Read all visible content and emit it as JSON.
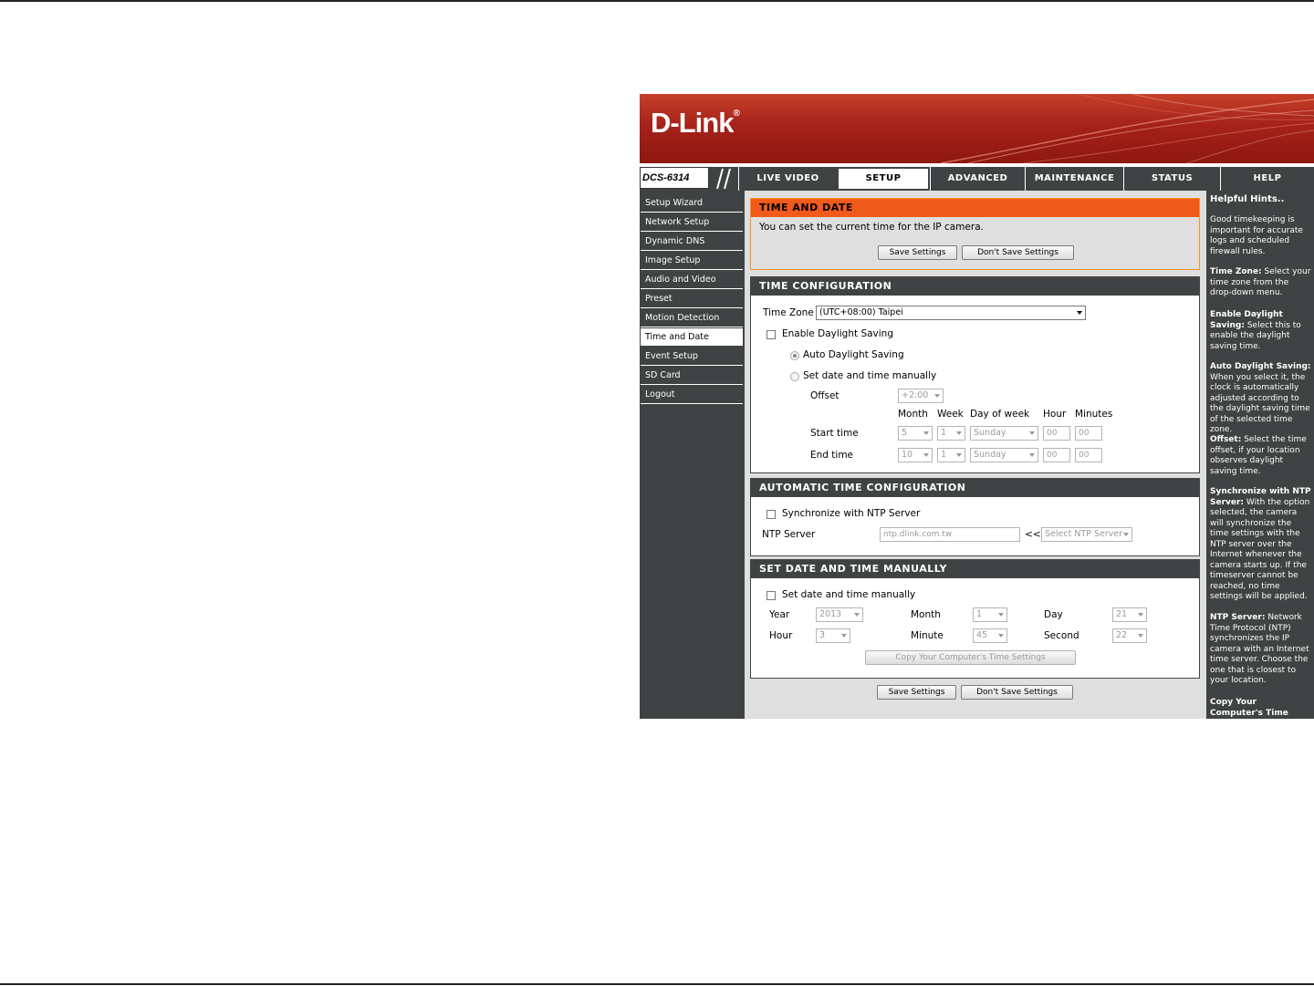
{
  "brand": {
    "logo_text": "D-Link",
    "registered": "®",
    "model": "DCS-6314"
  },
  "nav": {
    "tabs": [
      {
        "label": "LIVE VIDEO"
      },
      {
        "label": "SETUP",
        "active": true
      },
      {
        "label": "ADVANCED"
      },
      {
        "label": "MAINTENANCE"
      },
      {
        "label": "STATUS"
      },
      {
        "label": "HELP"
      }
    ]
  },
  "sidebar": {
    "items": [
      {
        "label": "Setup Wizard"
      },
      {
        "label": "Network Setup"
      },
      {
        "label": "Dynamic DNS"
      },
      {
        "label": "Image Setup"
      },
      {
        "label": "Audio and Video"
      },
      {
        "label": "Preset"
      },
      {
        "label": "Motion Detection"
      },
      {
        "label": "Time and Date",
        "active": true
      },
      {
        "label": "Event Setup"
      },
      {
        "label": "SD Card"
      },
      {
        "label": "Logout"
      }
    ]
  },
  "intro": {
    "title": "TIME AND DATE",
    "description": "You can set the current time for the IP camera.",
    "save_label": "Save Settings",
    "dont_save_label": "Don't Save Settings"
  },
  "time_config": {
    "title": "TIME CONFIGURATION",
    "time_zone_label": "Time Zone",
    "time_zone_value": "(UTC+08:00) Taipei",
    "daylight_label": "Enable Daylight Saving",
    "auto_daylight_label": "Auto Daylight Saving",
    "manual_daylight_label": "Set date and time manually",
    "offset_label": "Offset",
    "offset_value": "+2:00",
    "col_month": "Month",
    "col_week": "Week",
    "col_dow": "Day of week",
    "col_hour": "Hour",
    "col_minutes": "Minutes",
    "start_label": "Start time",
    "start": {
      "month": "5",
      "week": "1",
      "dow": "Sunday",
      "hour": "00",
      "minutes": "00"
    },
    "end_label": "End time",
    "end": {
      "month": "10",
      "week": "1",
      "dow": "Sunday",
      "hour": "00",
      "minutes": "00"
    }
  },
  "auto_time": {
    "title": "AUTOMATIC TIME CONFIGURATION",
    "sync_label": "Synchronize with NTP Server",
    "ntp_label": "NTP Server",
    "ntp_value": "ntp.dlink.com.tw",
    "arrows": "<<",
    "ntp_select": "Select NTP Server"
  },
  "manual_time": {
    "title": "SET DATE AND TIME MANUALLY",
    "set_label": "Set date and time manually",
    "year_label": "Year",
    "year_value": "2013",
    "month_label": "Month",
    "month_value": "1",
    "day_label": "Day",
    "day_value": "21",
    "hour_label": "Hour",
    "hour_value": "3",
    "minute_label": "Minute",
    "minute_value": "45",
    "second_label": "Second",
    "second_value": "22",
    "copy_label": "Copy Your Computer's Time Settings"
  },
  "footer": {
    "save_label": "Save Settings",
    "dont_save_label": "Don't Save Settings"
  },
  "hints": {
    "title": "Helpful Hints..",
    "intro": "Good timekeeping is important for accurate logs and scheduled firewall rules.",
    "tz_term": "Time Zone:",
    "tz_text": "Select your time zone from the drop-down menu.",
    "eds_term": "Enable Daylight Saving:",
    "eds_text": "Select this to enable the daylight saving time.",
    "ads_term": "Auto Daylight Saving:",
    "ads_text": "When you select it, the clock is automatically adjusted according to the daylight saving time of the selected time zone.",
    "off_term": "Offset:",
    "off_text": "Select the time offset, if your location observes daylight saving time.",
    "sync_term": "Synchronize with NTP Server:",
    "sync_text": "With the option selected, the camera will synchronize the time settings with the NTP server over the Internet whenever the camera starts up. If the timeserver cannot be reached, no time settings will be applied.",
    "ntp_term": "NTP Server:",
    "ntp_text": "Network Time Protocol (NTP) synchronizes the IP camera with an Internet time server. Choose the one that is closest to your location.",
    "copy_term": "Copy Your Computer's Time"
  }
}
